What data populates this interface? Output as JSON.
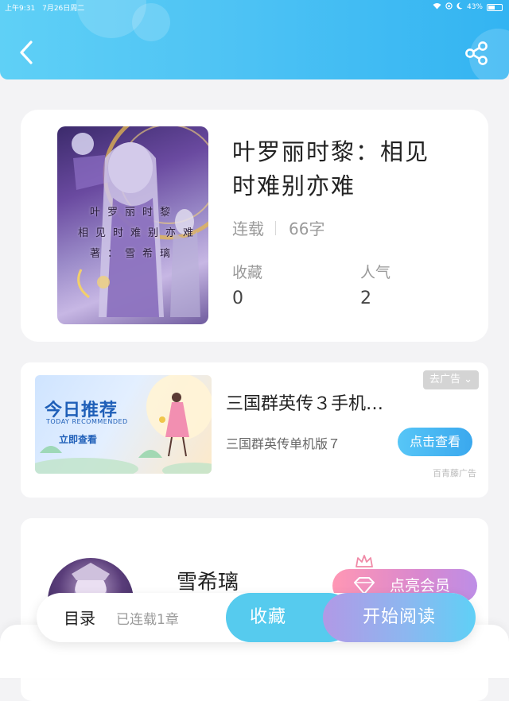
{
  "status_bar": {
    "time": "上午9:31",
    "date": "7月26日周二",
    "battery": "43%"
  },
  "header": {
    "back_icon": "chevron-left-icon",
    "share_icon": "share-icon",
    "color": "#4ec3f4"
  },
  "book": {
    "title_line1": "叶罗丽时黎：相见",
    "title_line2": "时难别亦难",
    "status": "连载",
    "word_count": "66字",
    "cover_text_lines": [
      "叶罗丽时黎",
      "相见时难别亦难",
      "著：雪希璃"
    ],
    "favorites_label": "收藏",
    "favorites_value": "0",
    "popularity_label": "人气",
    "popularity_value": "2"
  },
  "ad": {
    "banner_title": "今日推荐",
    "banner_subtitle": "TODAY RECOMMENDED",
    "banner_cta": "立即查看",
    "remove_label": "去广告 ⌄",
    "title": "三国群英传３手机…",
    "subtitle": "三国群英传单机版７",
    "button_label": "点击查看",
    "source": "百青藤广告"
  },
  "author": {
    "name": "雪希璃",
    "vip_label": "点亮会员",
    "vip_icons": [
      "crown-icon",
      "diamond-icon"
    ]
  },
  "bottom_bar": {
    "toc_label": "目录",
    "chapters_label": "已连载1章",
    "favorite_label": "收藏",
    "read_label": "开始阅读"
  },
  "colors": {
    "accent": "#4ec3f4",
    "favorite_button": "#56cbee",
    "vip": "#d988cf"
  }
}
